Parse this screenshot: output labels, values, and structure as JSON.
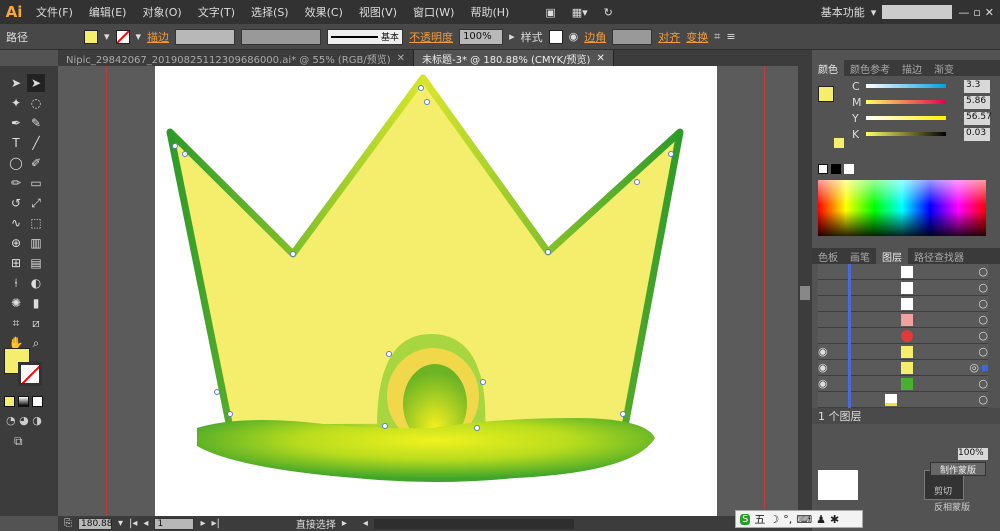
{
  "app": {
    "logo": "Ai",
    "menus": [
      "文件(F)",
      "编辑(E)",
      "对象(O)",
      "文字(T)",
      "选择(S)",
      "效果(C)",
      "视图(V)",
      "窗口(W)",
      "帮助(H)"
    ],
    "workspace": "基本功能"
  },
  "control": {
    "selection": "路径",
    "stroke_label": "描边",
    "stroke_style": "基本",
    "opacity_label": "不透明度",
    "opacity": "100%",
    "style_label": "样式",
    "corner_label": "边角",
    "align": "对齐",
    "transform": "变换",
    "fill_color": "#f5ee6c"
  },
  "tabs": [
    {
      "label": "Nipic_29842067_20190825112309686000.ai* @ 55% (RGB/预览)"
    },
    {
      "label": "未标题-3* @ 180.88% (CMYK/预览)"
    }
  ],
  "status": {
    "zoom": "180.88",
    "page": "1",
    "tool": "直接选择"
  },
  "color_panel": {
    "tabs": [
      "颜色",
      "颜色参考",
      "描边",
      "渐变"
    ],
    "channels": [
      {
        "name": "C",
        "value": "3.3"
      },
      {
        "name": "M",
        "value": "5.86"
      },
      {
        "name": "Y",
        "value": "56.57"
      },
      {
        "name": "K",
        "value": "0.03"
      }
    ]
  },
  "layers_panel": {
    "tabs": [
      "色板",
      "画笔",
      "图层",
      "路径查找器"
    ],
    "footer": "1 个图层"
  },
  "bottom_panel": {
    "opacity": "100%",
    "mask": "制作蒙版",
    "clip": "剪切",
    "invert": "反相蒙版"
  },
  "ime": {
    "label": "五"
  },
  "colors": {
    "crown_fill": "#f5ee6c",
    "green_dark": "#2e9a2a",
    "green_light": "#e8ef1e"
  }
}
